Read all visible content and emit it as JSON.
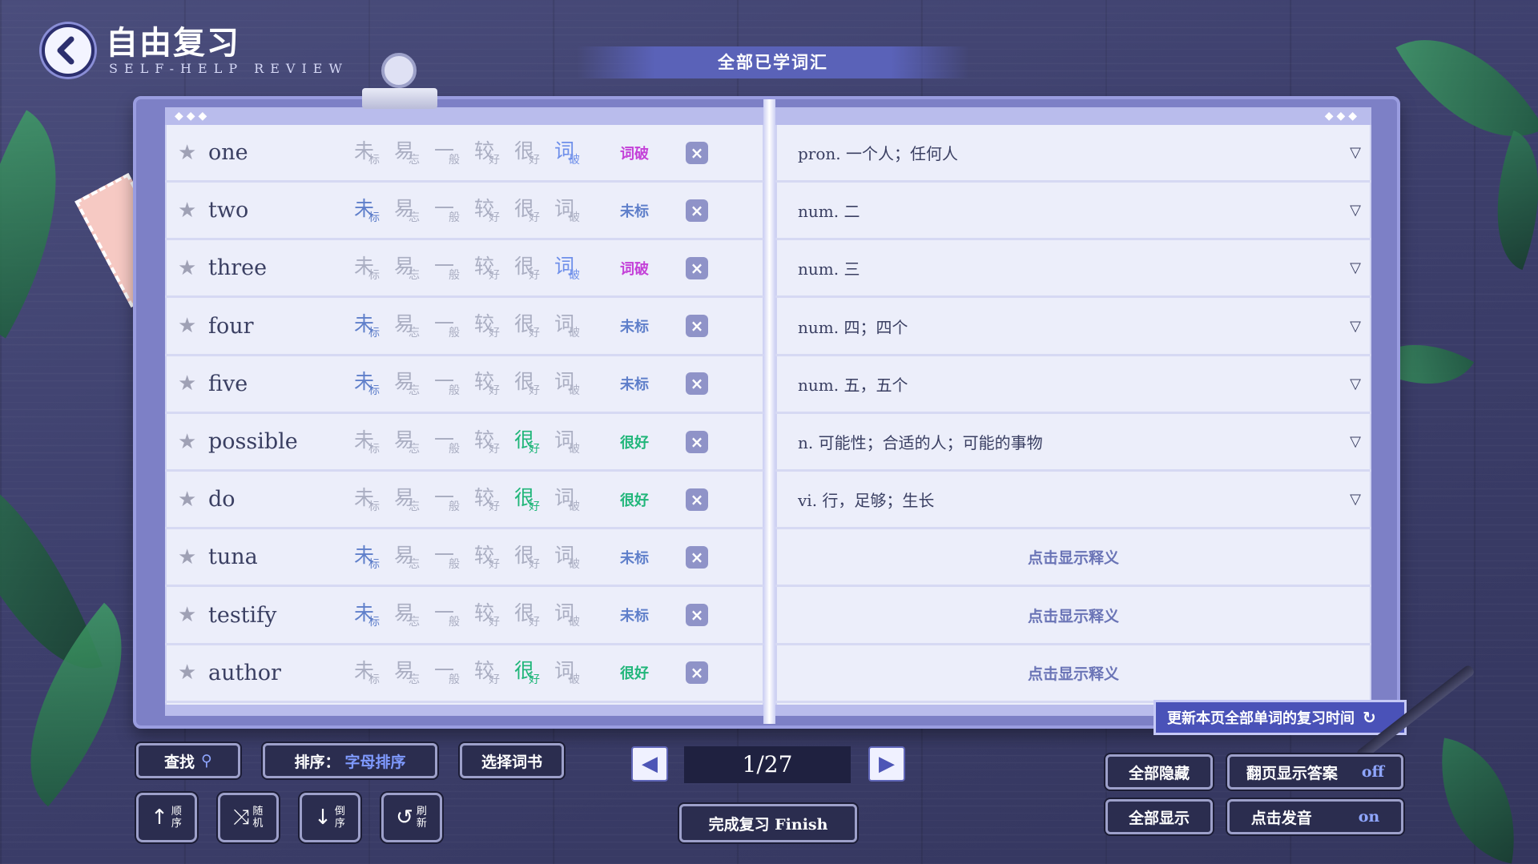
{
  "header": {
    "title": "自由复习",
    "subtitle": "SELF-HELP REVIEW"
  },
  "top_tab": "全部已学词汇",
  "level_icons": [
    {
      "main": "未",
      "sub": "标"
    },
    {
      "main": "易",
      "sub": "忘"
    },
    {
      "main": "一",
      "sub": "般"
    },
    {
      "main": "较",
      "sub": "好"
    },
    {
      "main": "很",
      "sub": "好"
    },
    {
      "main": "词",
      "sub": "破"
    }
  ],
  "words": [
    {
      "word": "one",
      "status": "词破",
      "definition": "pron. 一个人；任何人",
      "show_label": ""
    },
    {
      "word": "two",
      "status": "未标",
      "definition": "num. 二",
      "show_label": ""
    },
    {
      "word": "three",
      "status": "词破",
      "definition": "num. 三",
      "show_label": ""
    },
    {
      "word": "four",
      "status": "未标",
      "definition": "num. 四；四个",
      "show_label": ""
    },
    {
      "word": "five",
      "status": "未标",
      "definition": "num. 五，五个",
      "show_label": ""
    },
    {
      "word": "possible",
      "status": "很好",
      "definition": "n. 可能性；合适的人；可能的事物",
      "show_label": ""
    },
    {
      "word": "do",
      "status": "很好",
      "definition": "vi. 行，足够；生长",
      "show_label": ""
    },
    {
      "word": "tuna",
      "status": "未标",
      "definition": "",
      "show_label": "点击显示释义"
    },
    {
      "word": "testify",
      "status": "未标",
      "definition": "",
      "show_label": "点击显示释义"
    },
    {
      "word": "author",
      "status": "很好",
      "definition": "",
      "show_label": "点击显示释义"
    }
  ],
  "controls": {
    "search": "查找",
    "sort_label": "排序：",
    "sort_value": "字母排序",
    "select_book": "选择词书",
    "order_btns": [
      {
        "glyph": "↑",
        "text": "顺序"
      },
      {
        "glyph": "⤨",
        "text": "随机"
      },
      {
        "glyph": "↓",
        "text": "倒序"
      },
      {
        "glyph": "↺",
        "text": "刷新"
      }
    ],
    "page": "1/27",
    "finish": "完成复习 Finish",
    "update": "更新本页全部单词的复习时间",
    "hide_all": "全部隐藏",
    "show_all": "全部显示",
    "flip_show": "翻页显示答案",
    "flip_show_value": "off",
    "click_pron": "点击发音",
    "click_pron_value": "on"
  },
  "colors": {
    "status_unmarked": "#5f7fca",
    "status_good": "#21b67a",
    "status_broken": "#c441d8"
  }
}
